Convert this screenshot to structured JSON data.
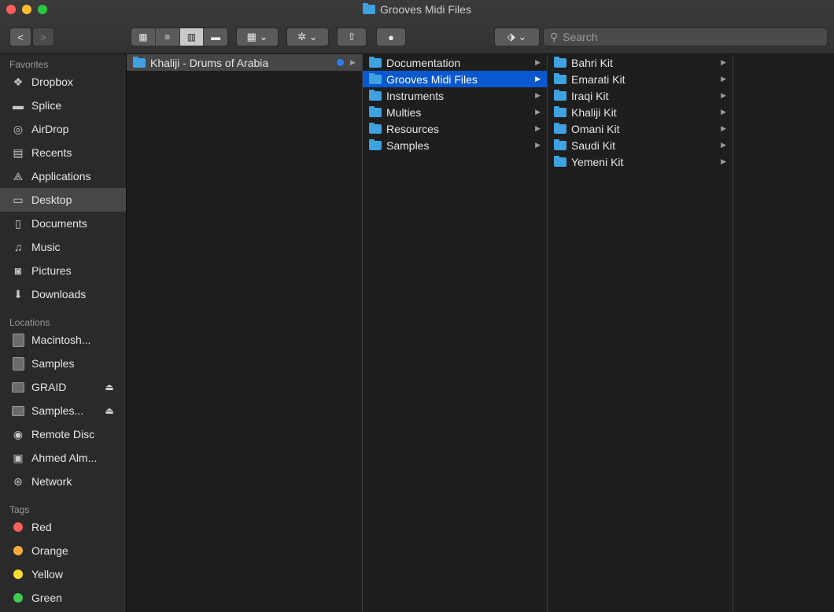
{
  "window": {
    "title": "Grooves Midi Files"
  },
  "toolbar": {
    "back": "<",
    "forward": ">",
    "views": [
      "▦",
      "≡",
      "▥",
      "▬"
    ],
    "group": "▦ ⌄",
    "action": "✲ ⌄",
    "share": "⇧",
    "tag": "●",
    "dropbox": "⬗ ⌄",
    "search_placeholder": "Search"
  },
  "sidebar": {
    "favorites_header": "Favorites",
    "favorites": [
      {
        "label": "Dropbox",
        "icon": "dropbox-icon"
      },
      {
        "label": "Splice",
        "icon": "folder-icon"
      },
      {
        "label": "AirDrop",
        "icon": "airdrop-icon"
      },
      {
        "label": "Recents",
        "icon": "recents-icon"
      },
      {
        "label": "Applications",
        "icon": "applications-icon"
      },
      {
        "label": "Desktop",
        "icon": "desktop-icon"
      },
      {
        "label": "Documents",
        "icon": "documents-icon"
      },
      {
        "label": "Music",
        "icon": "music-icon"
      },
      {
        "label": "Pictures",
        "icon": "pictures-icon"
      },
      {
        "label": "Downloads",
        "icon": "downloads-icon"
      }
    ],
    "locations_header": "Locations",
    "locations": [
      {
        "label": "Macintosh...",
        "icon": "hard-drive-icon"
      },
      {
        "label": "Samples",
        "icon": "hard-drive-icon"
      },
      {
        "label": "GRAID",
        "icon": "external-drive-icon"
      },
      {
        "label": "Samples...",
        "icon": "external-drive-icon"
      },
      {
        "label": "Remote Disc",
        "icon": "remote-disc-icon"
      },
      {
        "label": "Ahmed Alm...",
        "icon": "computer-icon"
      },
      {
        "label": "Network",
        "icon": "network-icon"
      }
    ],
    "tags_header": "Tags",
    "tags": [
      {
        "label": "Red",
        "color": "#fc605c"
      },
      {
        "label": "Orange",
        "color": "#fdaa3a"
      },
      {
        "label": "Yellow",
        "color": "#fddb33"
      },
      {
        "label": "Green",
        "color": "#3ecb52"
      }
    ]
  },
  "columns": {
    "col1": [
      "Khaliji - Drums of Arabia"
    ],
    "col2": [
      "Documentation",
      "Grooves Midi Files",
      "Instruments",
      "Multies",
      "Resources",
      "Samples"
    ],
    "col3": [
      "Bahri Kit",
      "Emarati Kit",
      "Iraqi Kit",
      "Khaliji Kit",
      "Omani Kit",
      "Saudi Kit",
      "Yemeni Kit"
    ]
  },
  "colors": {
    "selection": "#0a58d0",
    "folder": "#3ea1e0",
    "tag_blue": "#2f7df6"
  }
}
